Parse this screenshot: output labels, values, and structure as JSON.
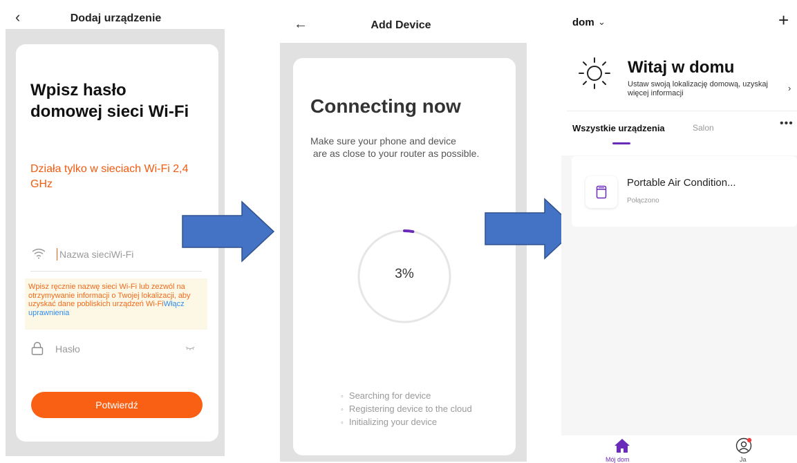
{
  "colors": {
    "accent_orange": "#fa6014",
    "warning_text": "#f25a0f",
    "link_blue": "#2d8cf0",
    "accent_purple": "#6a2bb8",
    "arrow_blue": "#4472c4",
    "arrow_border": "#2f528f"
  },
  "panel1": {
    "title": "Dodaj urządzenie",
    "heading": "Wpisz hasło domowej sieci Wi-Fi",
    "warning": "Działa tylko w sieciach Wi-Fi 2,4 GHz",
    "ssid_placeholder": "Nazwa sieciWi-Fi",
    "note": "Wpisz ręcznie nazwę sieci Wi-Fi lub zezwól na otrzymywanie informacji o Twojej lokalizacji, aby uzyskać dane pobliskich urządzeń Wi-Fi",
    "note_link": "Włącz uprawnienia",
    "password_placeholder": "Hasło",
    "confirm_button": "Potwierdź",
    "icons": [
      "back-icon",
      "wifi-icon",
      "lock-icon",
      "eye-closed-icon"
    ]
  },
  "panel2": {
    "title": "Add Device",
    "heading": "Connecting now",
    "subtitle": "Make sure your phone and device\n are as close to your router as possible.",
    "progress_text": "3%",
    "progress_value": 0.03,
    "steps": [
      "Searching for device",
      "Registering device to the cloud",
      "Initializing your device"
    ],
    "icons": [
      "back-arrow-icon"
    ]
  },
  "panel3": {
    "home_name": "dom",
    "welcome": "Witaj w domu",
    "location_prompt": "Ustaw swoją lokalizację domową, uzyskaj więcej informacji",
    "tabs": [
      "Wszystkie urządzenia",
      "Salon"
    ],
    "device": {
      "name": "Portable Air Condition...",
      "status": "Połączono"
    },
    "nav": [
      "Mój dom",
      "Ja"
    ],
    "icons": [
      "chevron-down-icon",
      "plus-icon",
      "sun-icon",
      "chevron-right-icon",
      "more-icon",
      "air-conditioner-icon",
      "house-icon",
      "user-icon"
    ]
  }
}
